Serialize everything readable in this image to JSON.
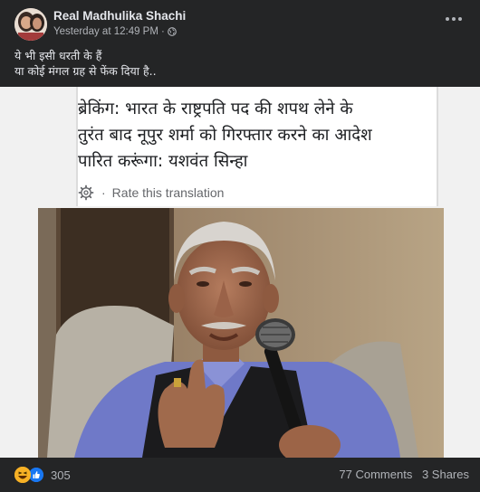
{
  "post": {
    "author": "Real Madhulika Shachi",
    "timestamp": "Yesterday at 12:49 PM",
    "visibility_icon": "globe-icon",
    "more_icon": "more-options-icon",
    "caption_lines": [
      "ये भी इसी धरती के हैं",
      "या कोई मंगल ग्रह से फेंक दिया है.."
    ]
  },
  "shared_image": {
    "headline_lines": [
      "ब्रेकिंग: भारत के राष्ट्रपति पद की शपथ लेने के",
      "तुरंत बाद नूपुर शर्मा को गिरफ्तार करने का आदेश",
      "पारित करूंगा: यशवंत सिन्हा"
    ],
    "rate_label": "Rate this translation",
    "rate_separator": "·",
    "gear_icon": "gear-icon"
  },
  "footer": {
    "reaction_icons": [
      "haha-reaction-icon",
      "like-reaction-icon"
    ],
    "reaction_count": "305",
    "comments": "77 Comments",
    "shares": "3 Shares"
  },
  "colors": {
    "background": "#242526",
    "text_primary": "#e4e6eb",
    "text_secondary": "#b0b3b8",
    "like_blue": "#1877f2",
    "haha_yellow": "#f7b125"
  }
}
